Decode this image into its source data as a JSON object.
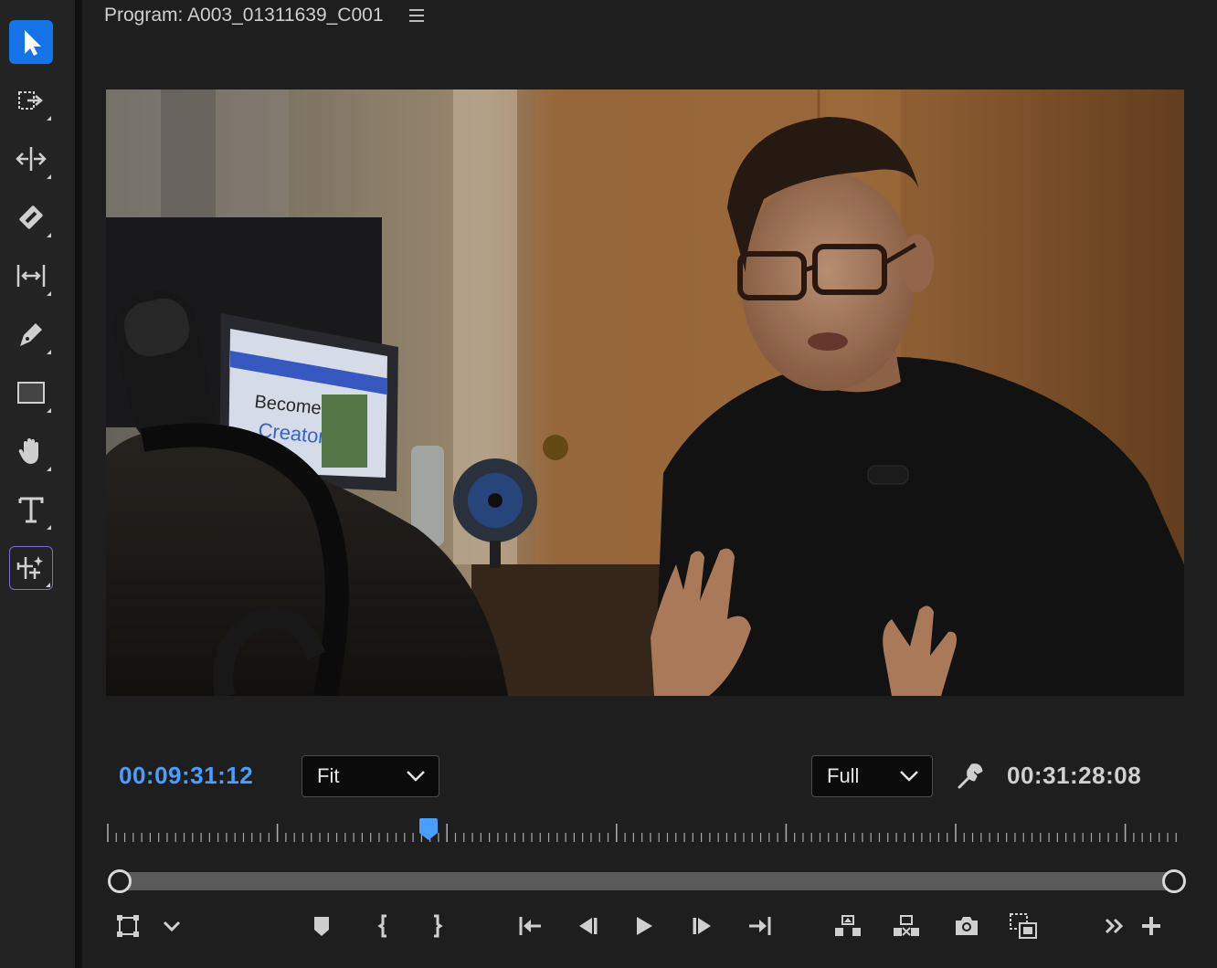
{
  "panel": {
    "title": "Program: A003_01311639_C001"
  },
  "tools": [
    {
      "name": "selection-tool",
      "icon": "arrow-icon",
      "active": true
    },
    {
      "name": "track-select-tool",
      "icon": "track-select-icon"
    },
    {
      "name": "ripple-edit-tool",
      "icon": "ripple-edit-icon"
    },
    {
      "name": "razor-tool",
      "icon": "razor-icon"
    },
    {
      "name": "slip-tool",
      "icon": "slip-icon"
    },
    {
      "name": "pen-tool",
      "icon": "pen-icon"
    },
    {
      "name": "rectangle-tool",
      "icon": "rectangle-icon"
    },
    {
      "name": "hand-tool",
      "icon": "hand-icon"
    },
    {
      "name": "type-tool",
      "icon": "type-icon"
    },
    {
      "name": "generative-extend-tool",
      "icon": "generative-extend-icon"
    }
  ],
  "playback": {
    "current_timecode": "00:09:31:12",
    "duration_timecode": "00:31:28:08",
    "zoom_level": "Fit",
    "resolution": "Full"
  },
  "timeline": {
    "playhead_position": 0.3
  },
  "colors": {
    "accent": "#1473e6",
    "timecode_blue": "#4a9eff"
  }
}
